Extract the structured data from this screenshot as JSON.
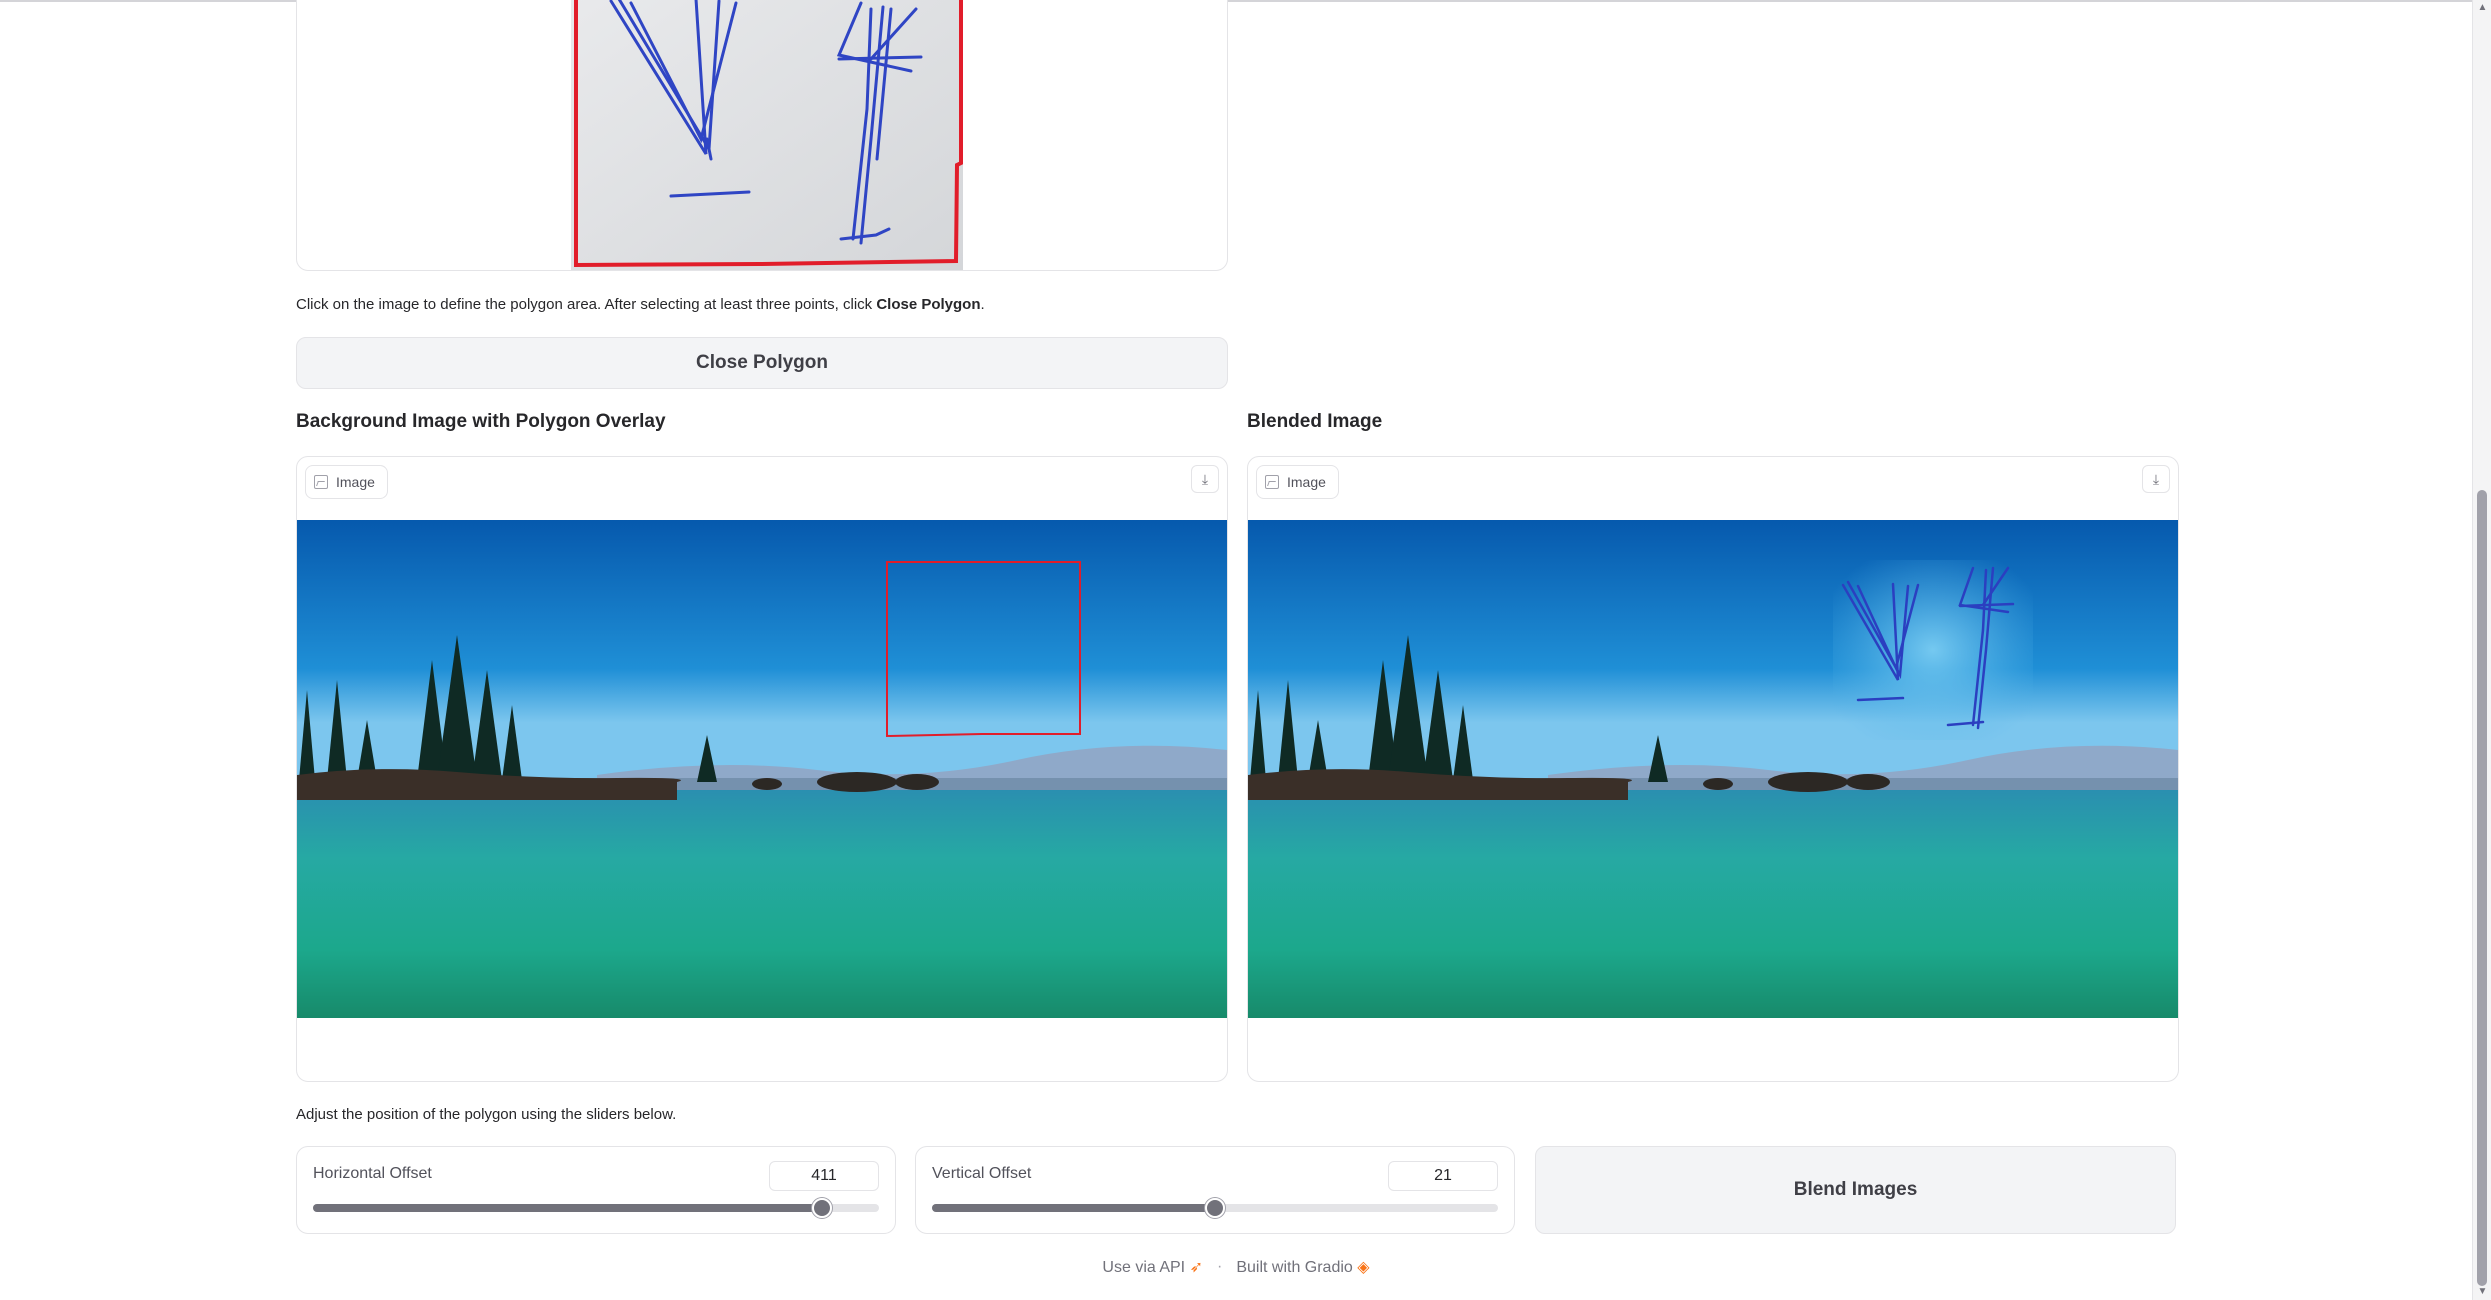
{
  "sketch_section": {
    "instruction_before": "Click on the image to define the polygon area. After selecting at least three points, click ",
    "instruction_bold": "Close Polygon",
    "instruction_after": ".",
    "close_button_label": "Close Polygon"
  },
  "overlay_panel": {
    "title": "Background Image with Polygon Overlay",
    "badge_label": "Image"
  },
  "blended_panel": {
    "title": "Blended Image",
    "badge_label": "Image"
  },
  "sliders_section": {
    "instruction": "Adjust the position of the polygon using the sliders below.",
    "horizontal": {
      "label": "Horizontal Offset",
      "value": "411",
      "fraction": 0.9
    },
    "vertical": {
      "label": "Vertical Offset",
      "value": "21",
      "fraction": 0.5
    },
    "blend_button_label": "Blend Images"
  },
  "footer": {
    "api_label": "Use via API",
    "separator": "·",
    "built_label": "Built with Gradio"
  },
  "icons": {
    "image_badge": "image-icon",
    "download": "download-icon",
    "api": "rocket-icon",
    "gradio": "gradio-logo-icon"
  },
  "colors": {
    "polygon_stroke": "#e11d2a",
    "sketch_ink": "#2f45c4",
    "sky_top": "#0a63b8",
    "water": "#1fa89a"
  }
}
